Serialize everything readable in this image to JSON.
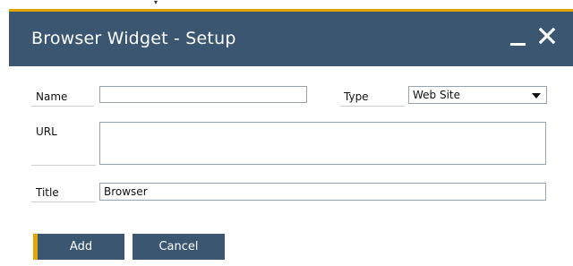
{
  "dialog": {
    "title": "Browser Widget - Setup",
    "minimize_icon": "minimize-icon",
    "close_icon": "close-icon"
  },
  "form": {
    "name_label": "Name",
    "name_value": "",
    "type_label": "Type",
    "type_value": "Web Site",
    "url_label": "URL",
    "url_value": "",
    "title_label": "Title",
    "title_value": "Browser"
  },
  "buttons": {
    "add_label": "Add",
    "cancel_label": "Cancel"
  },
  "colors": {
    "titlebar": "#3a5670",
    "accent": "#e0a800",
    "button": "#3a5670"
  }
}
